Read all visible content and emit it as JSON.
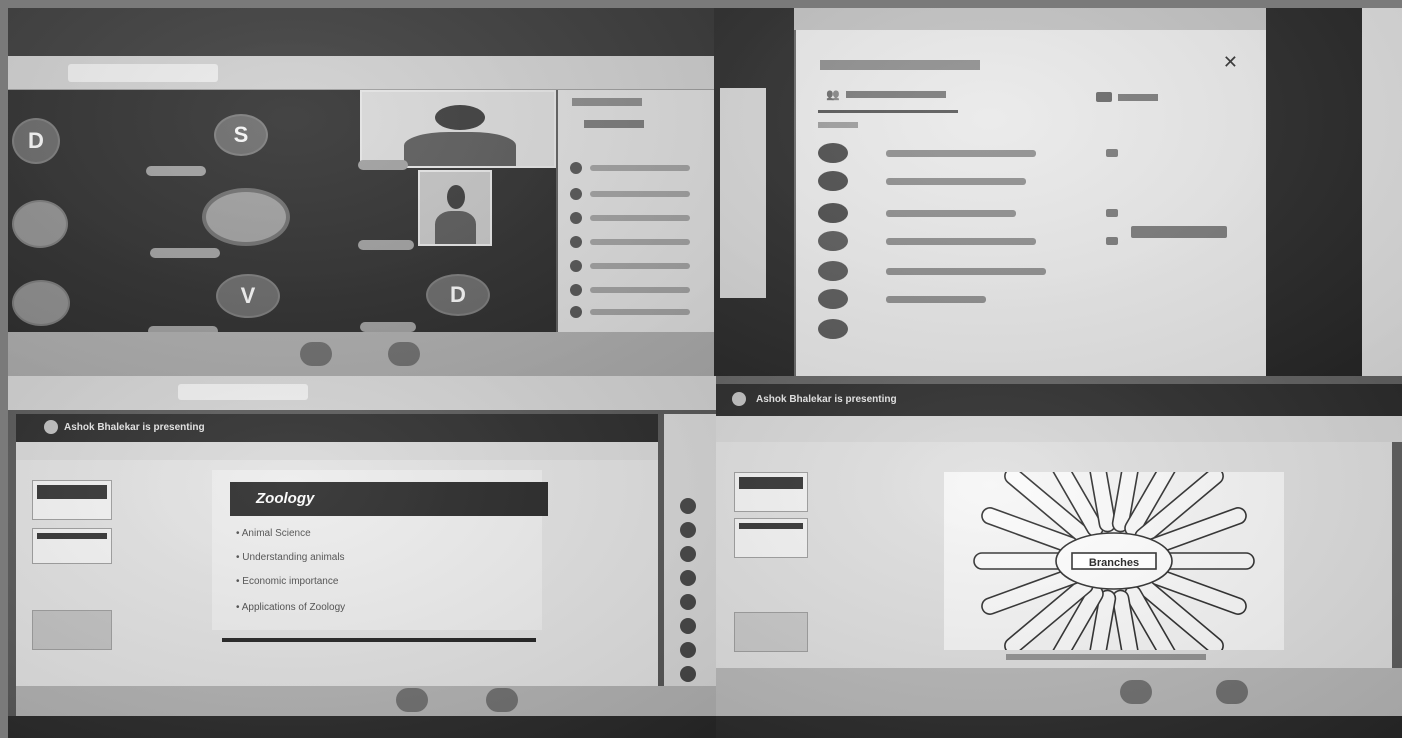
{
  "q1": {
    "participants": [
      {
        "name": "D",
        "kind": "initial"
      },
      {
        "name": "S",
        "kind": "initial"
      },
      {
        "name": "V",
        "kind": "initial"
      },
      {
        "name": "D",
        "kind": "initial"
      }
    ],
    "icons": [
      "mic-icon",
      "camera-icon"
    ]
  },
  "q3": {
    "presenting_banner": "Ashok Bhalekar is presenting",
    "slide_title": "Zoology",
    "bullets": [
      "Animal Science",
      "Understanding animals",
      "Economic importance",
      "Applications of Zoology"
    ]
  },
  "q4": {
    "presenting_banner": "Ashok Bhalekar is presenting",
    "center_label": "Branches"
  }
}
